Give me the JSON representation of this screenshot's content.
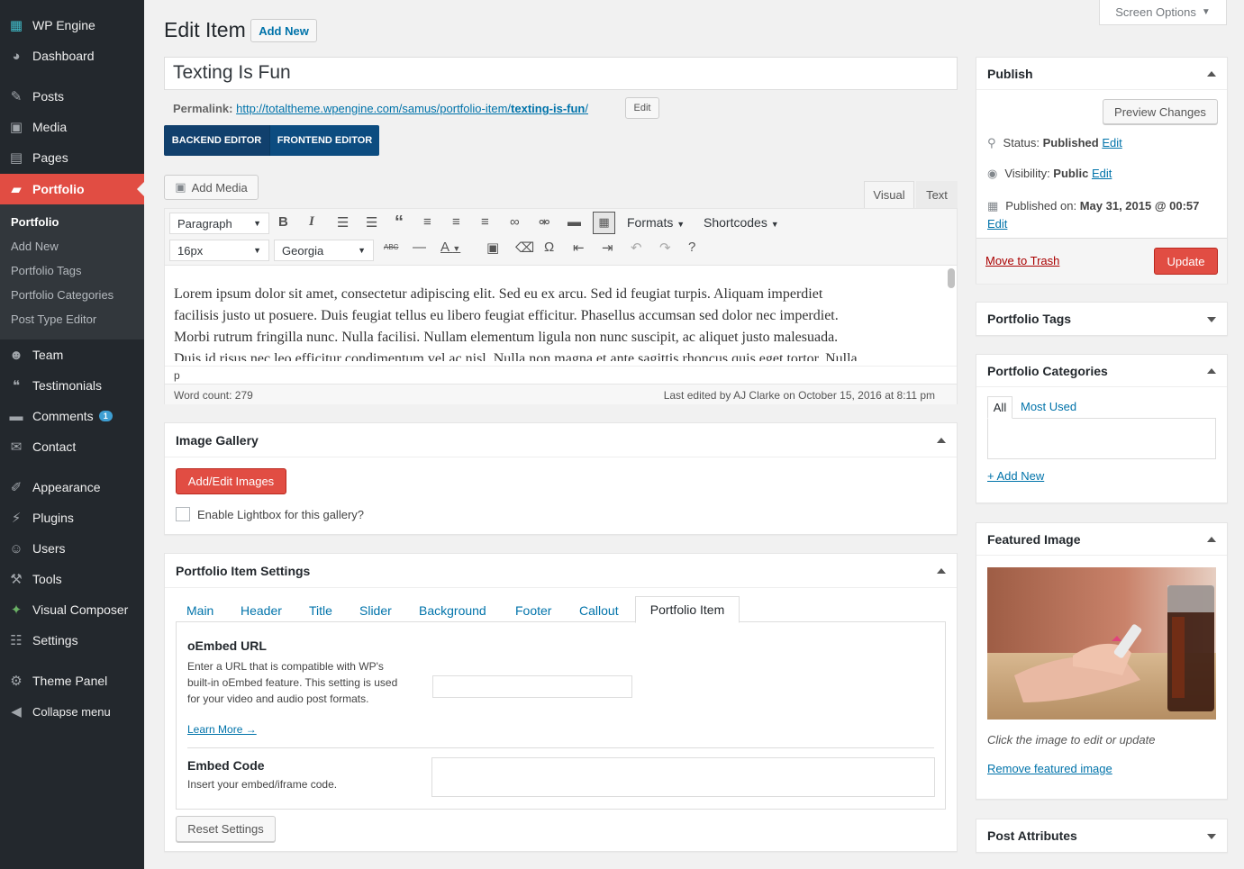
{
  "sidebar": {
    "site": "WP Engine",
    "dashboard": "Dashboard",
    "posts": "Posts",
    "media": "Media",
    "pages": "Pages",
    "portfolio": "Portfolio",
    "sub": [
      "Portfolio",
      "Add New",
      "Portfolio Tags",
      "Portfolio Categories",
      "Post Type Editor"
    ],
    "team": "Team",
    "testimonials": "Testimonials",
    "comments": "Comments",
    "comments_count": "1",
    "contact": "Contact",
    "appearance": "Appearance",
    "plugins": "Plugins",
    "users": "Users",
    "tools": "Tools",
    "vc": "Visual Composer",
    "settings": "Settings",
    "theme_panel": "Theme Panel",
    "collapse": "Collapse menu"
  },
  "header": {
    "title": "Edit Item",
    "add_new": "Add New",
    "screen_options": "Screen Options"
  },
  "post": {
    "title": "Texting Is Fun",
    "permalink_label": "Permalink:",
    "permalink_url": "http://totaltheme.wpengine.com/samus/portfolio-item/",
    "permalink_slug": "texting-is-fun",
    "permalink_end": "/",
    "edit": "Edit",
    "backend": "BACKEND EDITOR",
    "frontend": "FRONTEND EDITOR",
    "add_media": "Add Media",
    "visual": "Visual",
    "text": "Text",
    "para": "Paragraph",
    "formats": "Formats",
    "shortcodes": "Shortcodes",
    "size": "16px",
    "font": "Georgia",
    "content_l1": "Lorem ipsum dolor sit amet, consectetur adipiscing elit. Sed eu ex arcu. Sed id feugiat turpis. Aliquam imperdiet",
    "content_l2": "facilisis justo ut posuere. Duis feugiat tellus eu libero feugiat efficitur. Phasellus accumsan sed dolor nec imperdiet.",
    "content_l3": "Morbi rutrum fringilla nunc. Nulla facilisi. Nullam elementum ligula non nunc suscipit, ac aliquet justo malesuada.",
    "content_l4": "Duis id risus nec leo efficitur condimentum vel ac nisl. Nulla non magna et ante sagittis rhoncus quis eget tortor. Nulla",
    "path": "p",
    "word_count": "Word count: 279",
    "last_edited": "Last edited by AJ Clarke on October 15, 2016 at 8:11 pm"
  },
  "gallery": {
    "title": "Image Gallery",
    "button": "Add/Edit Images",
    "lightbox": "Enable Lightbox for this gallery?"
  },
  "settings": {
    "title": "Portfolio Item Settings",
    "tabs": [
      "Main",
      "Header",
      "Title",
      "Slider",
      "Background",
      "Footer",
      "Callout",
      "Portfolio Item"
    ],
    "oembed_label": "oEmbed URL",
    "oembed_desc": "Enter a URL that is compatible with WP's built-in oEmbed feature. This setting is used for your video and audio post formats.",
    "learn_more": "Learn More →",
    "embed_label": "Embed Code",
    "embed_desc": "Insert your embed/iframe code.",
    "reset": "Reset Settings"
  },
  "publish": {
    "title": "Publish",
    "preview": "Preview Changes",
    "status_label": "Status: ",
    "status": "Published",
    "visibility_label": "Visibility: ",
    "visibility": "Public",
    "published_label": "Published on: ",
    "published": "May 31, 2015 @ 00:57",
    "edit": "Edit",
    "trash": "Move to Trash",
    "update": "Update"
  },
  "tags": {
    "title": "Portfolio Tags"
  },
  "cats": {
    "title": "Portfolio Categories",
    "all": "All",
    "most_used": "Most Used",
    "add_new": "+ Add New"
  },
  "featured": {
    "title": "Featured Image",
    "hint": "Click the image to edit or update",
    "remove": "Remove featured image"
  },
  "attributes": {
    "title": "Post Attributes"
  }
}
